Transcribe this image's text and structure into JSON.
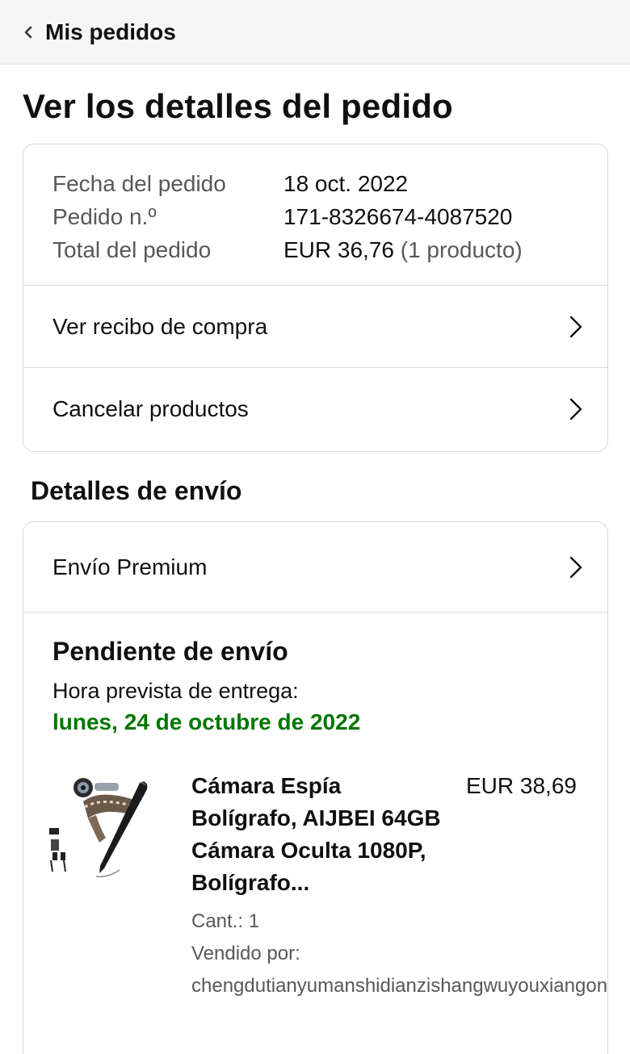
{
  "header": {
    "back_label": "Mis pedidos"
  },
  "page_title": "Ver los detalles del pedido",
  "order": {
    "date_label": "Fecha del pedido",
    "date_value": "18 oct. 2022",
    "number_label": "Pedido n.º",
    "number_value": "171-8326674-4087520",
    "total_label": "Total del pedido",
    "total_value": "EUR 36,76",
    "total_items": "(1 producto)"
  },
  "actions": {
    "receipt": "Ver recibo de compra",
    "cancel": "Cancelar productos"
  },
  "shipping": {
    "section_title": "Detalles de envío",
    "method": "Envío Premium",
    "status": "Pendiente de envío",
    "eta_label": "Hora prevista de entrega:",
    "eta_date": "lunes, 24 de octubre de 2022"
  },
  "product": {
    "title": "Cámara Espía Bolígrafo, AIJBEI 64GB Cámara Oculta 1080P, Bolígrafo...",
    "price": "EUR 38,69",
    "qty": "Cant.: 1",
    "sold_by_label": "Vendido por:",
    "seller": "chengdutianyumanshidianzishangwuyouxiangongsi"
  },
  "colors": {
    "eta_green": "#007600",
    "muted_text": "#565959",
    "border": "#d5d9d9"
  }
}
